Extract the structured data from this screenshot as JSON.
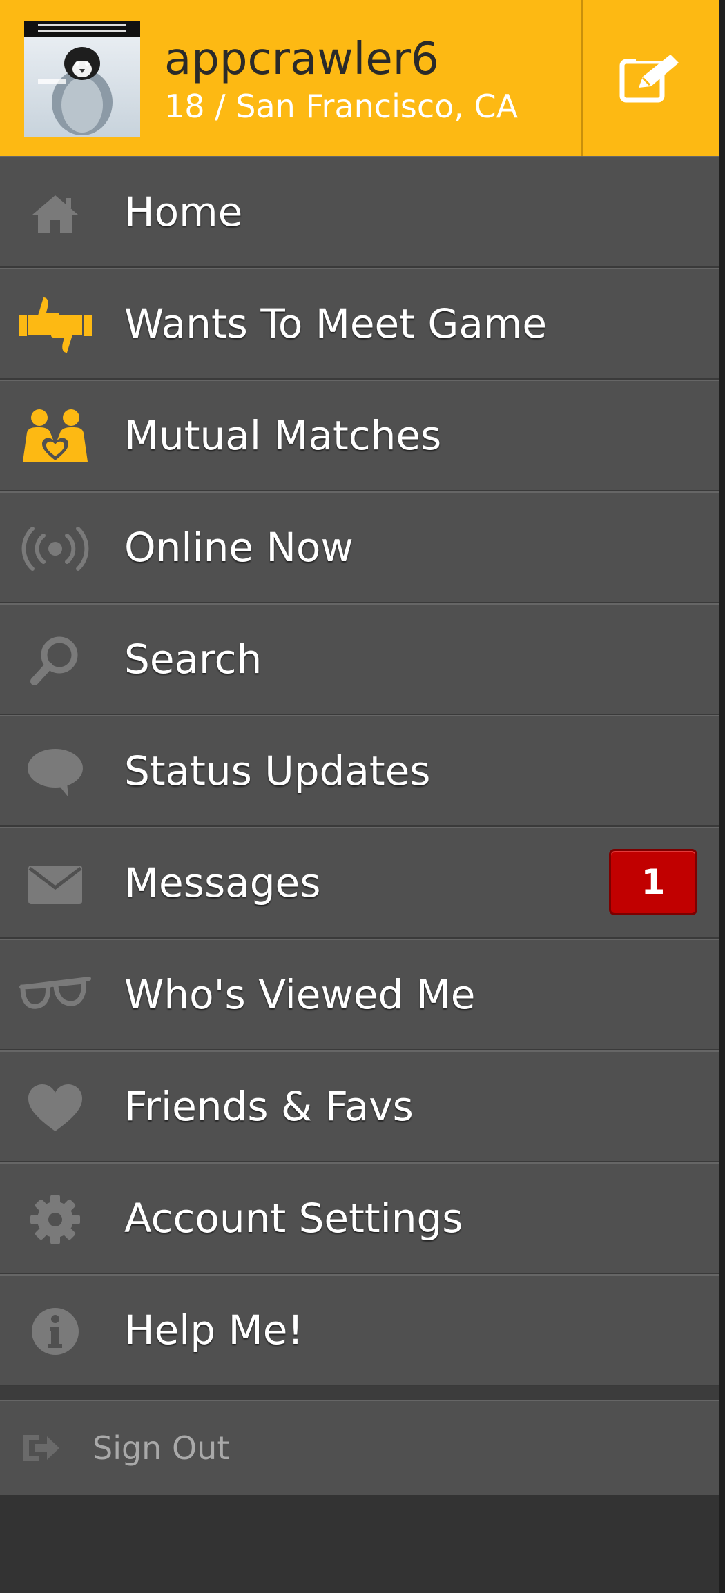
{
  "header": {
    "username": "appcrawler6",
    "subline": "18 / San Francisco, CA",
    "avatar_icon": "profile-photo-penguin",
    "edit_icon": "edit-icon"
  },
  "menu": {
    "items": [
      {
        "label": "Home",
        "icon": "home-icon"
      },
      {
        "label": "Wants To Meet Game",
        "icon": "thumbs-up-down-icon"
      },
      {
        "label": "Mutual Matches",
        "icon": "mutual-matches-icon"
      },
      {
        "label": "Online Now",
        "icon": "broadcast-icon"
      },
      {
        "label": "Search",
        "icon": "search-icon"
      },
      {
        "label": "Status Updates",
        "icon": "speech-bubble-icon"
      },
      {
        "label": "Messages",
        "icon": "envelope-icon",
        "badge": "1"
      },
      {
        "label": "Who's Viewed Me",
        "icon": "glasses-icon"
      },
      {
        "label": "Friends & Favs",
        "icon": "heart-icon"
      },
      {
        "label": "Account Settings",
        "icon": "gear-icon"
      },
      {
        "label": "Help Me!",
        "icon": "info-icon"
      }
    ]
  },
  "signout": {
    "label": "Sign Out",
    "icon": "sign-out-icon"
  },
  "colors": {
    "header_bg": "#FDB913",
    "menu_bg": "#505050",
    "accent_icon": "#FDB913",
    "muted_icon": "#7a7a7a",
    "badge_bg": "#C10000"
  }
}
